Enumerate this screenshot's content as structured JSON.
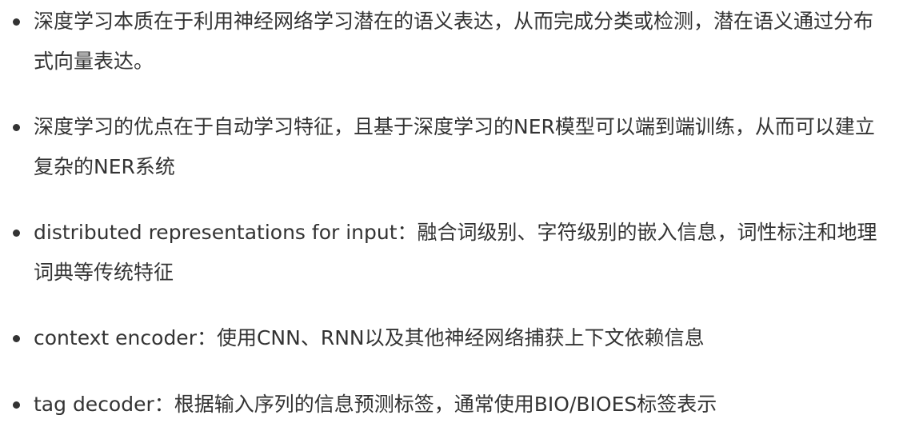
{
  "bullets": [
    {
      "text": "深度学习本质在于利用神经网络学习潜在的语义表达，从而完成分类或检测，潜在语义通过分布式向量表达。"
    },
    {
      "text": "深度学习的优点在于自动学习特征，且基于深度学习的NER模型可以端到端训练，从而可以建立复杂的NER系统"
    },
    {
      "text": "distributed representations for input：融合词级别、字符级别的嵌入信息，词性标注和地理词典等传统特征"
    },
    {
      "text": "context encoder：使用CNN、RNN以及其他神经网络捕获上下文依赖信息"
    },
    {
      "text": "tag decoder：根据输入序列的信息预测标签，通常使用BIO/BIOES标签表示"
    }
  ]
}
